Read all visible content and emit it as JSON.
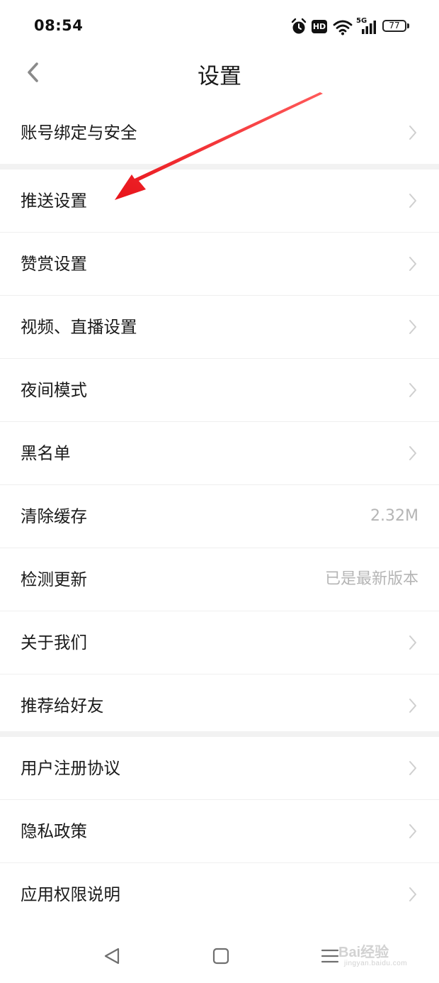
{
  "status_bar": {
    "time": "08:54",
    "hd_label": "HD",
    "network_label": "5G",
    "battery": "77",
    "icons": [
      "alarm-icon",
      "hd-icon",
      "wifi-icon",
      "signal-icon",
      "battery-icon"
    ]
  },
  "header": {
    "title": "设置",
    "back_icon": "chevron-left-icon"
  },
  "groups": [
    {
      "items": [
        {
          "label": "账号绑定与安全"
        }
      ]
    },
    {
      "items": [
        {
          "label": "推送设置"
        },
        {
          "label": "赞赏设置"
        },
        {
          "label": "视频、直播设置"
        },
        {
          "label": "夜间模式"
        },
        {
          "label": "黑名单"
        },
        {
          "label": "清除缓存",
          "value": "2.32M"
        },
        {
          "label": "检测更新",
          "value": "已是最新版本"
        },
        {
          "label": "关于我们"
        },
        {
          "label": "推荐给好友"
        }
      ]
    },
    {
      "items": [
        {
          "label": "用户注册协议"
        },
        {
          "label": "隐私政策"
        },
        {
          "label": "应用权限说明"
        }
      ]
    }
  ],
  "system_nav": {
    "icons": [
      "back-triangle-icon",
      "home-square-icon",
      "menu-lines-icon"
    ]
  },
  "watermark": {
    "text": "Bai经验",
    "subtext": "jingyan.baidu.com"
  },
  "annotation": {
    "color": "#e8141b"
  }
}
